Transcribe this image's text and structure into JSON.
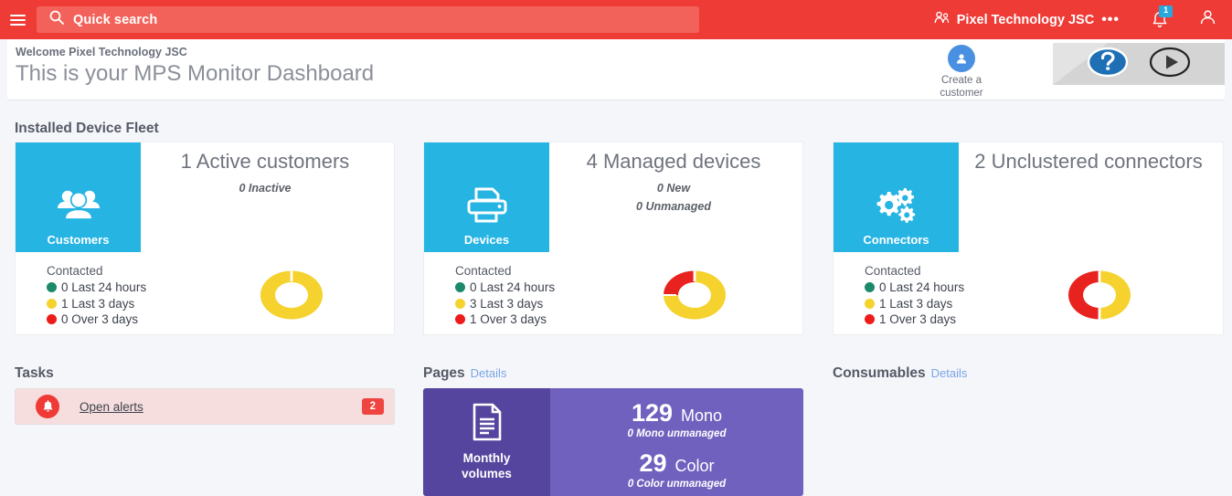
{
  "topbar": {
    "menu_icon": "hamburger-icon",
    "search": {
      "icon": "search-icon",
      "placeholder": "Quick search",
      "value": ""
    },
    "account_name": "Pixel Technology JSC",
    "account_icon": "user-group-icon",
    "overflow": "•••",
    "notifications": {
      "icon": "bell-icon",
      "count": "1"
    },
    "profile_icon": "user-icon",
    "bg_color": "#ee3b36",
    "search_bg": "#f2625a",
    "badge_color": "#28a7dd"
  },
  "welcome": {
    "greeting": "Welcome Pixel Technology JSC",
    "title": "This is your MPS Monitor Dashboard",
    "create_customer": {
      "label_line1": "Create a",
      "label_line2": "customer",
      "icon": "add-user-icon"
    },
    "help_icon": "help-question-icon",
    "play_icon": "play-icon"
  },
  "fleet": {
    "title": "Installed Device Fleet",
    "cards": [
      {
        "panel_label": "Customers",
        "panel_icon": "customers-group-icon",
        "headline": "1 Active customers",
        "sub": [
          "0 Inactive"
        ],
        "contacted_title": "Contacted",
        "contacted": [
          {
            "color": "#1c8a6a",
            "text": "0 Last 24 hours"
          },
          {
            "color": "#f5d22d",
            "text": "1 Last 3 days"
          },
          {
            "color": "#ee1b1b",
            "text": "0 Over 3 days"
          }
        ],
        "donut": {
          "yellow": 1,
          "red": 0,
          "green": 0
        }
      },
      {
        "panel_label": "Devices",
        "panel_icon": "printer-icon",
        "headline": "4 Managed devices",
        "sub": [
          "0 New",
          "0 Unmanaged"
        ],
        "contacted_title": "Contacted",
        "contacted": [
          {
            "color": "#1c8a6a",
            "text": "0 Last 24 hours"
          },
          {
            "color": "#f5d22d",
            "text": "3 Last 3 days"
          },
          {
            "color": "#ee1b1b",
            "text": "1 Over 3 days"
          }
        ],
        "donut": {
          "yellow": 3,
          "red": 1,
          "green": 0
        }
      },
      {
        "panel_label": "Connectors",
        "panel_icon": "gears-icon",
        "headline": "2 Unclustered connectors",
        "sub": [],
        "contacted_title": "Contacted",
        "contacted": [
          {
            "color": "#1c8a6a",
            "text": "0 Last 24 hours"
          },
          {
            "color": "#f5d22d",
            "text": "1 Last 3 days"
          },
          {
            "color": "#ee1b1b",
            "text": "1 Over 3 days"
          }
        ],
        "donut": {
          "yellow": 1,
          "red": 1,
          "green": 0
        }
      }
    ]
  },
  "tasks": {
    "title": "Tasks",
    "alert": {
      "icon": "bell-icon",
      "label": "Open alerts",
      "count": "2"
    }
  },
  "pages": {
    "title": "Pages",
    "details_label": "Details",
    "panel_label_line1": "Monthly",
    "panel_label_line2": "volumes",
    "panel_icon": "document-icon",
    "mono_value": "129",
    "mono_label": "Mono",
    "mono_sub": "0 Mono unmanaged",
    "color_value": "29",
    "color_label": "Color",
    "color_sub": "0 Color unmanaged",
    "panel_color": "#55459e",
    "body_color": "#7161bf"
  },
  "consumables": {
    "title": "Consumables",
    "details_label": "Details"
  },
  "chart_data": [
    {
      "type": "pie",
      "title": "Customers contacted",
      "categories": [
        "Last 24 hours",
        "Last 3 days",
        "Over 3 days"
      ],
      "values": [
        0,
        1,
        0
      ],
      "colors": [
        "#1c8a6a",
        "#f5d22d",
        "#ee1b1b"
      ]
    },
    {
      "type": "pie",
      "title": "Devices contacted",
      "categories": [
        "Last 24 hours",
        "Last 3 days",
        "Over 3 days"
      ],
      "values": [
        0,
        3,
        1
      ],
      "colors": [
        "#1c8a6a",
        "#f5d22d",
        "#ee1b1b"
      ]
    },
    {
      "type": "pie",
      "title": "Connectors contacted",
      "categories": [
        "Last 24 hours",
        "Last 3 days",
        "Over 3 days"
      ],
      "values": [
        0,
        1,
        1
      ],
      "colors": [
        "#1c8a6a",
        "#f5d22d",
        "#ee1b1b"
      ]
    }
  ]
}
